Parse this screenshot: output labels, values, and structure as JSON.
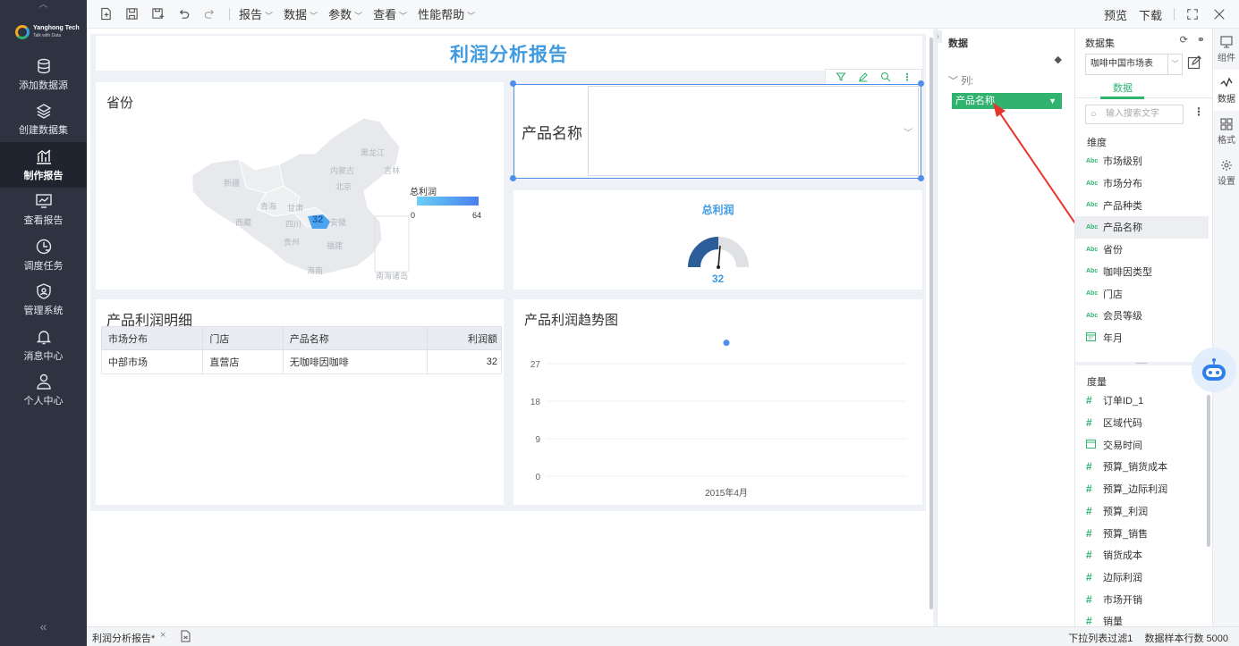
{
  "leftnav": {
    "brand": "Yanghong Tech",
    "brand_sub": "Talk with Data",
    "items": [
      {
        "label": "添加数据源",
        "icon": "database-icon"
      },
      {
        "label": "创建数据集",
        "icon": "layers-icon"
      },
      {
        "label": "制作报告",
        "icon": "chart-icon",
        "active": true
      },
      {
        "label": "查看报告",
        "icon": "monitor-chart-icon"
      },
      {
        "label": "调度任务",
        "icon": "clock-task-icon"
      },
      {
        "label": "管理系统",
        "icon": "shield-user-icon"
      },
      {
        "label": "消息中心",
        "icon": "bell-icon"
      },
      {
        "label": "个人中心",
        "icon": "user-icon"
      }
    ],
    "collapse": "«"
  },
  "toolbar": {
    "menus": [
      "报告",
      "数据",
      "参数",
      "查看",
      "性能帮助"
    ],
    "preview": "预览",
    "download": "下载"
  },
  "report": {
    "title": "利润分析报告",
    "map": {
      "title": "省份",
      "legend_title": "总利润",
      "legend_min": "0",
      "legend_max": "64",
      "highlight_value": "32",
      "regions": [
        "黑龙江",
        "吉林",
        "内蒙古",
        "北京",
        "新疆",
        "青海",
        "甘肃",
        "西藏",
        "四川",
        "安徽",
        "贵州",
        "福建",
        "海南",
        "南海诸岛"
      ]
    },
    "filter": {
      "label": "产品名称",
      "value": ""
    },
    "gauge": {
      "title": "总利润",
      "value": "32"
    },
    "table": {
      "title": "产品利润明细",
      "columns": [
        "市场分布",
        "门店",
        "产品名称",
        "利润额"
      ],
      "rows": [
        [
          "中部市场",
          "直营店",
          "无咖啡因咖啡",
          "32"
        ]
      ]
    },
    "trend": {
      "title": "产品利润趋势图"
    }
  },
  "chart_data": {
    "type": "scatter",
    "title": "产品利润趋势图",
    "categories": [
      "2015年4月"
    ],
    "values": [
      32
    ],
    "yticks": [
      "0",
      "9",
      "18",
      "27"
    ],
    "ylim": [
      0,
      36
    ]
  },
  "datapanel": {
    "title": "数据",
    "col_label": "列:",
    "chip": "产品名称"
  },
  "dataset": {
    "title": "数据集",
    "selected": "咖啡中国市场表",
    "tab": "数据",
    "search_placeholder": "输入搜索文字",
    "dimension_title": "维度",
    "dimensions": [
      "市场级别",
      "市场分布",
      "产品种类",
      "产品名称",
      "省份",
      "咖啡因类型",
      "门店",
      "会员等级",
      "年月"
    ],
    "measure_title": "度量",
    "measures": [
      {
        "label": "订单ID_1",
        "type": "num"
      },
      {
        "label": "区域代码",
        "type": "num"
      },
      {
        "label": "交易时间",
        "type": "date"
      },
      {
        "label": "预算_销货成本",
        "type": "num"
      },
      {
        "label": "预算_边际利润",
        "type": "num"
      },
      {
        "label": "预算_利润",
        "type": "num"
      },
      {
        "label": "预算_销售",
        "type": "num"
      },
      {
        "label": "销货成本",
        "type": "num"
      },
      {
        "label": "边际利润",
        "type": "num"
      },
      {
        "label": "市场开销",
        "type": "num"
      },
      {
        "label": "销量",
        "type": "num"
      }
    ]
  },
  "rightstrip": [
    "组件",
    "数据",
    "格式",
    "设置"
  ],
  "statusbar": {
    "tab": "利润分析报告*",
    "close": "×",
    "filter_info": "下拉列表过滤1",
    "sample_info": "数据样本行数 5000"
  },
  "colors": {
    "accent": "#2fb36f",
    "title_blue": "#3e9be0",
    "nav_bg": "#2d3340"
  }
}
